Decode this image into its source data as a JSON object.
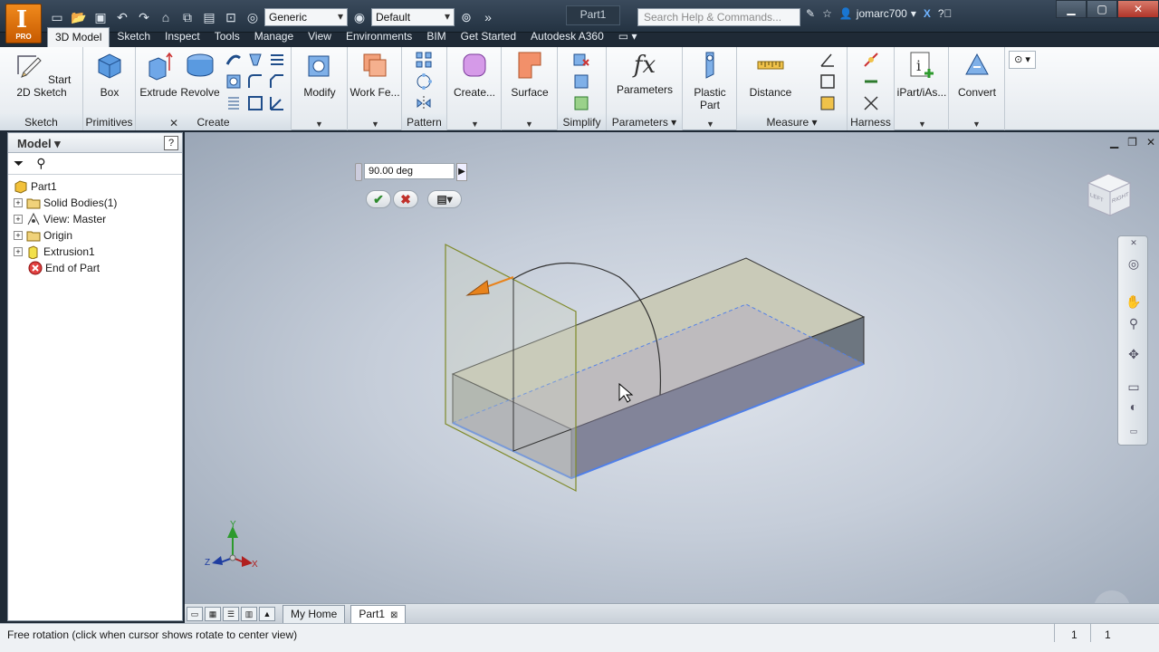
{
  "app": {
    "logo_letter": "I",
    "logo_sub": "PRO",
    "document_title": "Part1"
  },
  "quick_access": {
    "material": "Generic",
    "appearance": "Default",
    "search_placeholder": "Search Help & Commands...",
    "user": "jomarc700"
  },
  "tabs": [
    "3D Model",
    "Sketch",
    "Inspect",
    "Tools",
    "Manage",
    "View",
    "Environments",
    "BIM",
    "Get Started",
    "Autodesk A360"
  ],
  "ribbon": {
    "start_sketch": "Start\n2D Sketch",
    "box": "Box",
    "extrude": "Extrude",
    "revolve": "Revolve",
    "modify": "Modify",
    "work_features": "Work Fe...",
    "create_freeform": "Create...",
    "surface": "Surface",
    "parameters": "Parameters",
    "plastic_part": "Plastic Part",
    "distance": "Distance",
    "ipart": "iPart/iAs...",
    "convert": "Convert",
    "panels": {
      "sketch": "Sketch",
      "primitives": "Primitives",
      "create": "Create",
      "pattern": "Pattern",
      "simplify": "Simplify",
      "parameters": "Parameters",
      "measure": "Measure",
      "harness": "Harness"
    }
  },
  "browser": {
    "title": "Model",
    "tree": [
      {
        "label": "Part1",
        "expandable": false
      },
      {
        "label": "Solid Bodies(1)",
        "expandable": true
      },
      {
        "label": "View: Master",
        "expandable": true
      },
      {
        "label": "Origin",
        "expandable": true
      },
      {
        "label": "Extrusion1",
        "expandable": true
      },
      {
        "label": "End of Part",
        "expandable": false
      }
    ]
  },
  "viewport": {
    "angle_value": "90.00 deg",
    "axis_labels": {
      "x": "X",
      "y": "Y",
      "z": "Z"
    },
    "viewcube_faces": {
      "left": "LEFT",
      "right": "RIGHT"
    }
  },
  "doc_tabs": [
    "My Home",
    "Part1"
  ],
  "status": {
    "text": "Free rotation (click when cursor shows rotate to center view)",
    "count_a": "1",
    "count_b": "1"
  },
  "colors": {
    "accent_orange": "#e8831c",
    "edge_blue": "#4f7fe8",
    "sketch_green": "#7f8a2a"
  }
}
